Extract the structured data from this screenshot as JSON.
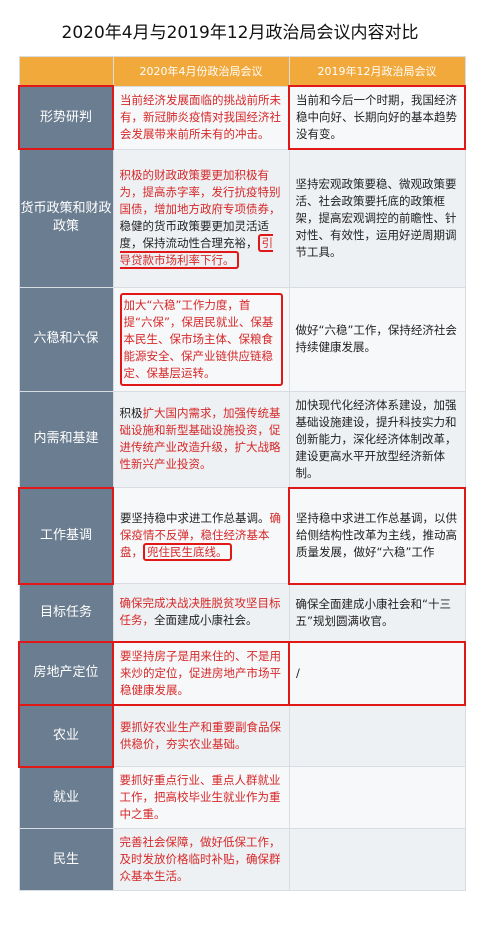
{
  "title": "2020年4月与2019年12月政治局会议内容对比",
  "columns": [
    "",
    "2020年4月份政治局会议",
    "2019年12月政治局会议"
  ],
  "rows": [
    {
      "label": "形势研判",
      "a_red": "当前经济发展面临的挑战前所未有，新冠肺炎疫情对我国经济社会发展带来前所未有的冲击。",
      "a_dark": "",
      "b": "当前和今后一个时期，我国经济稳中向好、长期向好的基本趋势没有变。"
    },
    {
      "label": "货币政策和财政政策",
      "a_red": "积极的财政政策要更加积极有为，提高赤字率，发行抗疫特别国债，增加地方政府专项债券，",
      "a_dark": "稳健的货币政策要更加灵活适度，保持流动性合理充裕，",
      "a_red2": "引导贷款市场利率下行。",
      "b": "坚持宏观政策要稳、微观政策要活、社会政策要托底的政策框架，提高宏观调控的前瞻性、针对性、有效性，运用好逆周期调节工具。"
    },
    {
      "label": "六稳和六保",
      "a_red": "加大“六稳”工作力度，首提“六保”，保居民就业、保基本民生、保市场主体、保粮食能源安全、保产业链供应链稳定、保基层运转。",
      "a_dark": "",
      "b": "做好“六稳”工作，保持经济社会持续健康发展。"
    },
    {
      "label": "内需和基建",
      "a_red": "扩大国内需求，加强传统基础设施和新型基础设施投资，促进传统产业改造升级，扩大战略性新兴产业投资。",
      "a_dark": "积极",
      "b": "加快现代化经济体系建设，加强基础设施建设，提升科技实力和创新能力，深化经济体制改革，建设更高水平开放型经济新体制。"
    },
    {
      "label": "工作基调",
      "a_dark": "要坚持稳中求进工作总基调。",
      "a_red": "确保疫情不反弹，稳住经济基本盘，",
      "a_red2": "兜住民生底线。",
      "b": "坚持稳中求进工作总基调，以供给侧结构性改革为主线，推动高质量发展，做好“六稳”工作"
    },
    {
      "label": "目标任务",
      "a_red": "确保完成决战决胜脱贫攻坚目标任务，",
      "a_dark": "全面建成小康社会。",
      "b": "确保全面建成小康社会和“十三五”规划圆满收官。"
    },
    {
      "label": "房地产定位",
      "a_red": "要坚持房子是用来住的、不是用来炒的定位，促进房地产市场平稳健康发展。",
      "a_dark": "",
      "b": "/"
    },
    {
      "label": "农业",
      "a_red": "要抓好农业生产和重要副食品保供稳价，夯实农业基础。",
      "a_dark": "",
      "b": ""
    },
    {
      "label": "就业",
      "a_red": "要抓好重点行业、重点人群就业工作，把高校毕业生就业作为重中之重。",
      "a_dark": "",
      "b": ""
    },
    {
      "label": "民生",
      "a_red": "完善社会保障，做好低保工作，及时发放价格临时补贴，确保群众基本生活。",
      "a_dark": "",
      "b": ""
    }
  ]
}
